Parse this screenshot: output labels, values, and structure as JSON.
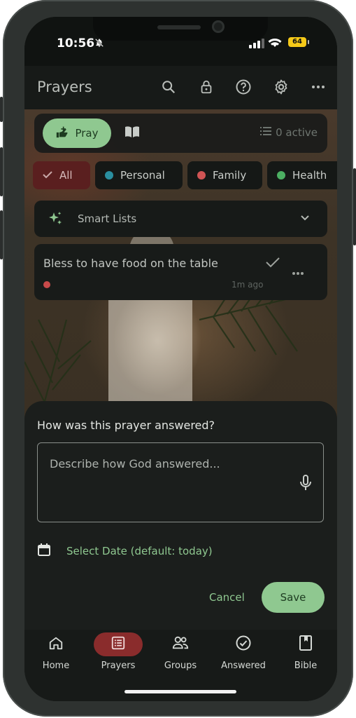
{
  "status_bar": {
    "time": "10:56",
    "battery": "64"
  },
  "app_bar": {
    "title": "Prayers"
  },
  "mode_bar": {
    "pray_label": "Pray",
    "active_label": "0 active"
  },
  "chips": [
    {
      "label": "All",
      "color": "#8e2f2f"
    },
    {
      "label": "Personal",
      "color": "#2a8fa0"
    },
    {
      "label": "Family",
      "color": "#d05454"
    },
    {
      "label": "Health",
      "color": "#4caf62"
    }
  ],
  "smart_lists": {
    "label": "Smart Lists"
  },
  "prayer_card": {
    "text": "Bless to have food on the table",
    "time_ago": "1m ago",
    "color": "#c84a4a"
  },
  "answer_sheet": {
    "question": "How was this prayer answered?",
    "placeholder": "Describe how God answered...",
    "date_label": "Select Date (default: today)",
    "cancel_label": "Cancel",
    "save_label": "Save"
  },
  "nav": {
    "items": [
      {
        "label": "Home",
        "icon": "home-icon"
      },
      {
        "label": "Prayers",
        "icon": "list-icon",
        "selected": true
      },
      {
        "label": "Groups",
        "icon": "groups-icon"
      },
      {
        "label": "Answered",
        "icon": "check-circle-icon"
      },
      {
        "label": "Bible",
        "icon": "bookmark-book-icon"
      }
    ]
  },
  "colors": {
    "accent": "#8fc890",
    "selected_nav": "#8a2c2c",
    "background": "#121513"
  }
}
